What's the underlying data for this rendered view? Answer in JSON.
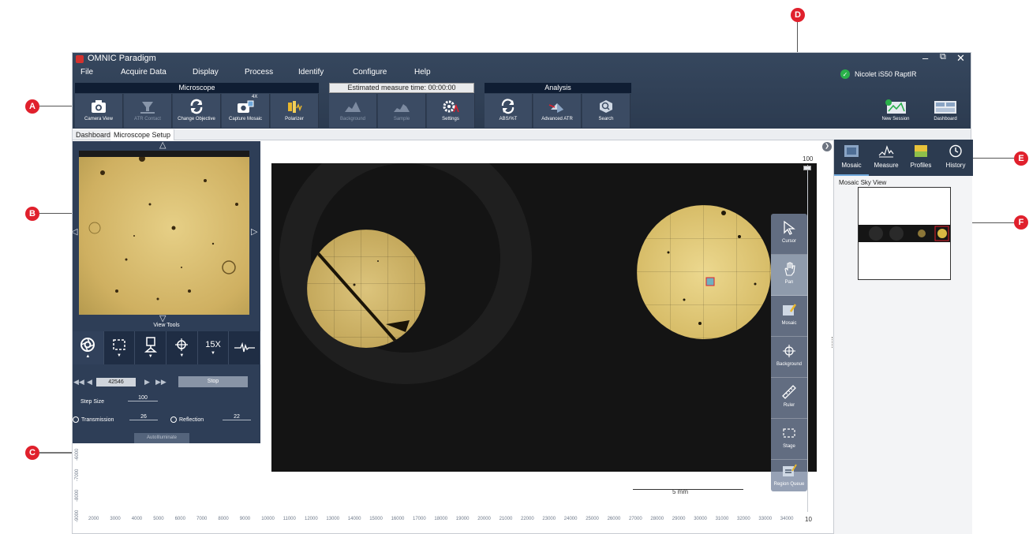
{
  "callouts": [
    "A",
    "B",
    "C",
    "D",
    "E",
    "F"
  ],
  "window": {
    "title": "OMNIC Paradigm",
    "controls": {
      "minimize": "–",
      "restore": "⧉",
      "close": "✕"
    }
  },
  "menu": [
    "File",
    "Acquire Data",
    "Display",
    "Process",
    "Identify",
    "Configure",
    "Help"
  ],
  "instrument": {
    "name": "Nicolet iS50 RaptIR",
    "status_color": "#2ab04a"
  },
  "toolbar": {
    "microscope_header": "Microscope",
    "estimate": "Estimated measure time: 00:00:00",
    "analysis_header": "Analysis",
    "camera_view": "Camera View",
    "atr_contact": "ATR Contact",
    "change_objective": "Change Objective",
    "capture_mosaic": "Capture Mosaic",
    "capture_mosaic_badge": "4X",
    "polarizer": "Polarizer",
    "background": "Background",
    "sample": "Sample",
    "settings": "Settings",
    "abs_t": "ABS/%T",
    "advanced_atr": "Advanced ATR",
    "search": "Search",
    "new_session": "New Session",
    "dashboard": "Dashboard"
  },
  "tabs": [
    "Dashboard",
    "Microscope Setup"
  ],
  "left_panel": {
    "view_tools": "View Tools",
    "objective": "15X",
    "position": "42546",
    "stop": "Stop",
    "step_size_label": "Step Size",
    "step_size": "100",
    "transmission_label": "Transmission",
    "transmission": "26",
    "reflection_label": "Reflection",
    "reflection": "22",
    "autoilluminate": "AutoIlluminate"
  },
  "main_view": {
    "scale_label": "5 mm",
    "zoom_max": "100",
    "zoom_min": "10",
    "x_ticks": [
      "2000",
      "3000",
      "4000",
      "5000",
      "6000",
      "7000",
      "8000",
      "9000",
      "10000",
      "11000",
      "12000",
      "13000",
      "14000",
      "15000",
      "16000",
      "17000",
      "18000",
      "19000",
      "20000",
      "21000",
      "22000",
      "23000",
      "24000",
      "25000",
      "26000",
      "27000",
      "28000",
      "29000",
      "30000",
      "31000",
      "32000",
      "33000",
      "34000"
    ],
    "y_ticks": [
      "-6000",
      "-7000",
      "-8000",
      "-9000"
    ]
  },
  "palette": [
    "Cursor",
    "Pan",
    "Mosaic",
    "Background",
    "Ruler",
    "Stage",
    "Region Queue"
  ],
  "right_panel": {
    "tabs": [
      "Mosaic",
      "Measure",
      "Profiles",
      "History"
    ],
    "sky_view_label": "Mosaic Sky View"
  },
  "colors": {
    "accent_red": "#e0202c",
    "titlebar": "#2c3b50",
    "panel": "#2e3e57"
  }
}
